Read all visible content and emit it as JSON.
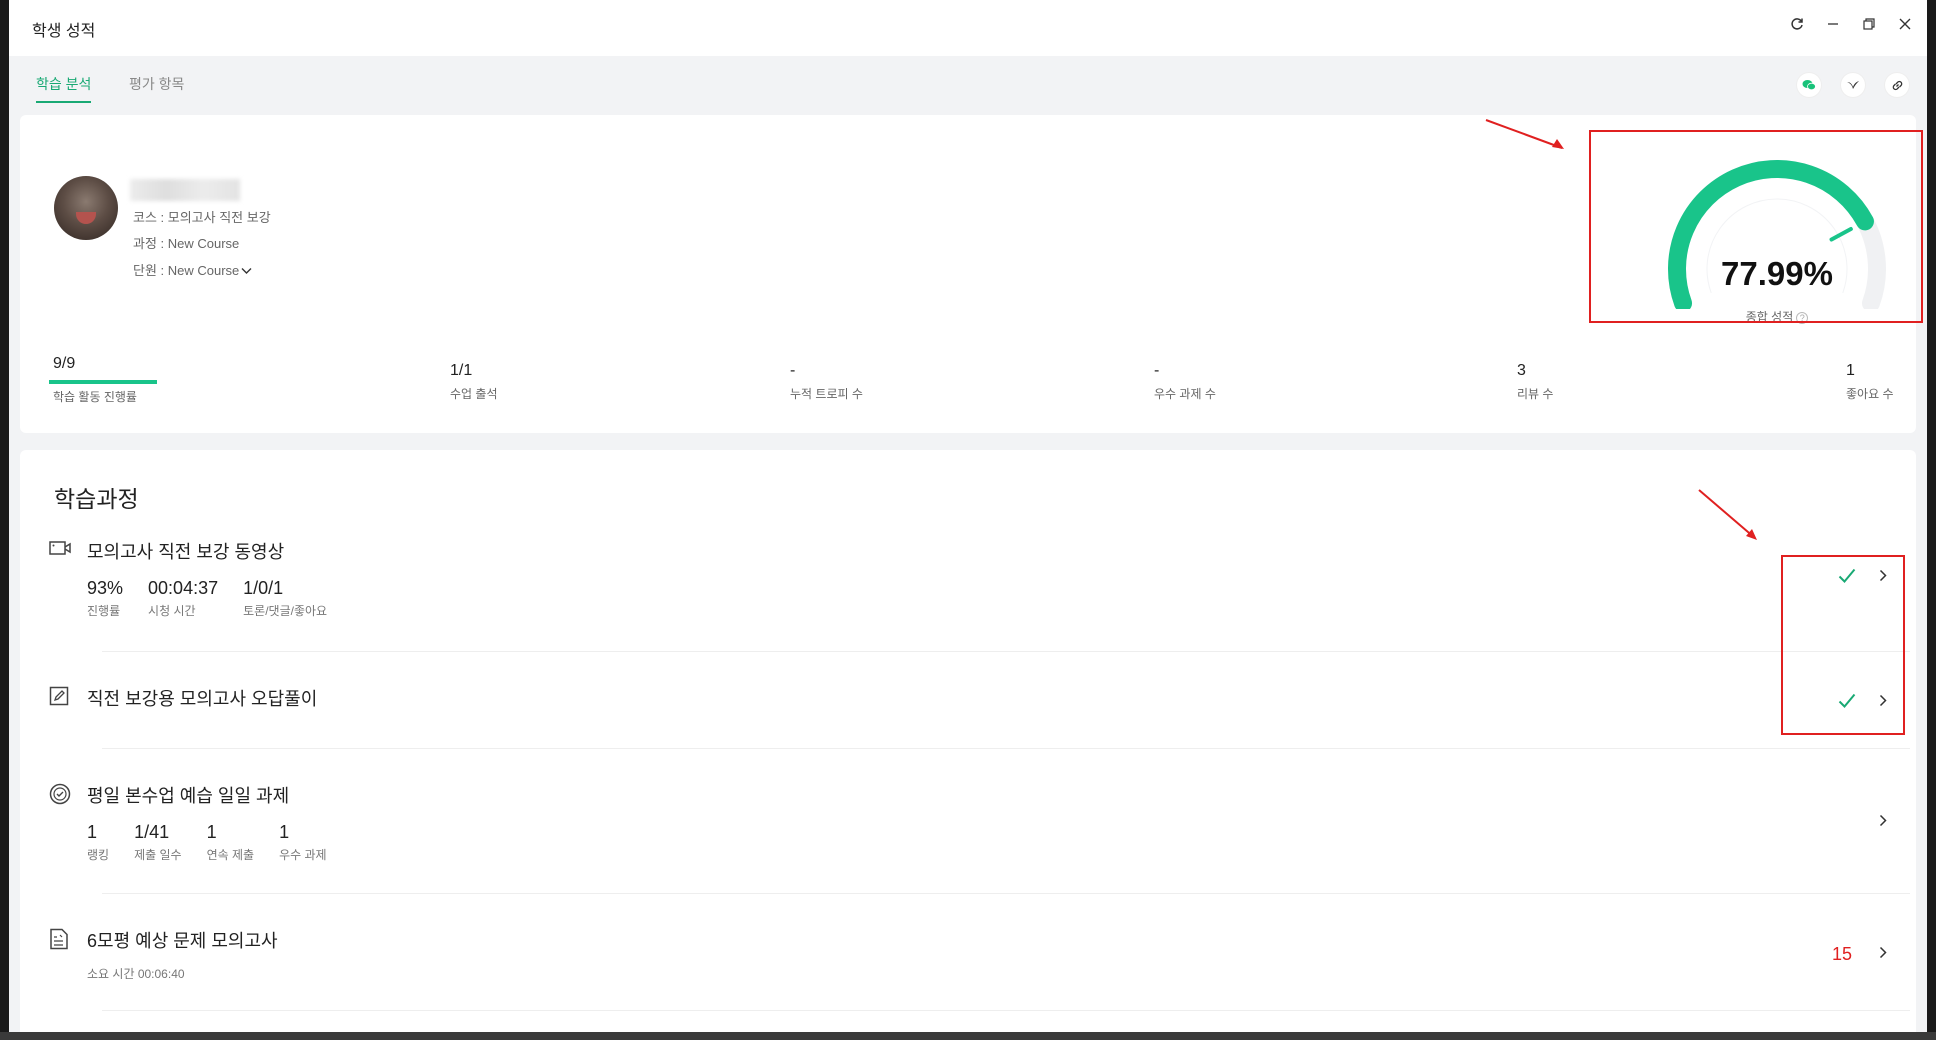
{
  "window": {
    "title": "학생 성적"
  },
  "tabs": [
    {
      "label": "학습 분석"
    },
    {
      "label": "평가 항목"
    }
  ],
  "profile": {
    "course_line": "코스 : 모의고사 직전 보강",
    "curriculum_line": "과정 : New Course",
    "unit_line": "단원 : New Course"
  },
  "gauge": {
    "value": "77.99%",
    "label": "종합 성적",
    "fraction": 0.7799,
    "color": "#19c48a"
  },
  "stats": [
    {
      "value": "9/9",
      "label": "학습 활동 진행률",
      "progress": 1.0
    },
    {
      "value": "1/1",
      "label": "수업 출석"
    },
    {
      "value": "-",
      "label": "누적 트로피 수"
    },
    {
      "value": "-",
      "label": "우수 과제 수"
    },
    {
      "value": "3",
      "label": "리뷰 수"
    },
    {
      "value": "1",
      "label": "좋아요 수"
    }
  ],
  "course": {
    "title": "학습과정",
    "items": [
      {
        "name": "모의고사 직전 보강 동영상",
        "icon": "video-icon",
        "metrics": [
          {
            "value": "93%",
            "label": "진행률"
          },
          {
            "value": "00:04:37",
            "label": "시청 시간"
          },
          {
            "value": "1/0/1",
            "label": "토론/댓글/좋아요"
          }
        ],
        "status": "check"
      },
      {
        "name": "직전 보강용 모의고사 오답풀이",
        "icon": "edit-icon",
        "status": "check"
      },
      {
        "name": "평일 본수업 예습 일일 과제",
        "icon": "task-check-icon",
        "metrics": [
          {
            "value": "1",
            "label": "랭킹"
          },
          {
            "value": "1/41",
            "label": "제출 일수"
          },
          {
            "value": "1",
            "label": "연속 제출"
          },
          {
            "value": "1",
            "label": "우수 과제"
          }
        ]
      },
      {
        "name": "6모평 예상 문제 모의고사",
        "icon": "exam-icon",
        "sub": "소요 시간 00:06:40",
        "score": "15"
      }
    ]
  },
  "accent_color": "#19a974",
  "annotation_color": "#e02020"
}
